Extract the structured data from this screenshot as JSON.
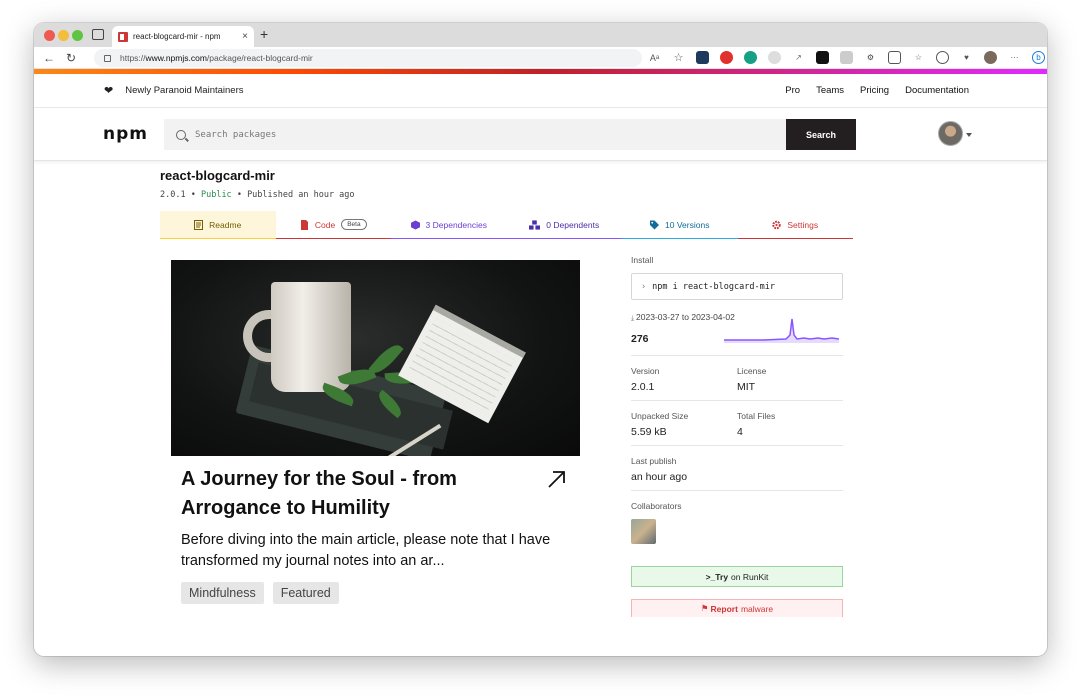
{
  "browser": {
    "tab_title": "react-blogcard-mir - npm",
    "new_tab": "+",
    "url_prefix": "https://",
    "url_domain": "www.npmjs.com",
    "url_path": "/package/react-blogcard-mir"
  },
  "topbar": {
    "tagline": "Newly Paranoid Maintainers",
    "links": [
      "Pro",
      "Teams",
      "Pricing",
      "Documentation"
    ]
  },
  "header": {
    "logo": "npm",
    "search_placeholder": "Search packages",
    "search_button": "Search"
  },
  "package": {
    "name": "react-blogcard-mir",
    "version": "2.0.1",
    "visibility": "Public",
    "published": "Published an hour ago",
    "sep": "•"
  },
  "tabs": {
    "readme": "Readme",
    "code": "Code",
    "code_badge": "Beta",
    "dependencies": "3 Dependencies",
    "dependents": "0 Dependents",
    "versions": "10 Versions",
    "settings": "Settings"
  },
  "readme": {
    "card_title": "A Journey for the Soul - from Arrogance to Humility",
    "card_description": "Before diving into the main article, please note that I have transformed my journal notes into an ar...",
    "tags": [
      "Mindfulness",
      "Featured"
    ]
  },
  "sidebar": {
    "install_label": "Install",
    "install_command": "npm i react-blogcard-mir",
    "downloads_range": "2023-03-27 to 2023-04-02",
    "weekly_downloads": "276",
    "version_label": "Version",
    "version_value": "2.0.1",
    "license_label": "License",
    "license_value": "MIT",
    "unpacked_label": "Unpacked Size",
    "unpacked_value": "5.59 kB",
    "files_label": "Total Files",
    "files_value": "4",
    "last_publish_label": "Last publish",
    "last_publish_value": "an hour ago",
    "collaborators_label": "Collaborators",
    "runkit_prefix": ">_Try",
    "runkit_suffix": "on RunKit",
    "report_prefix": "Report",
    "report_suffix": "malware"
  },
  "colors": {
    "npm_red": "#cb3837",
    "spark_purple": "#8956ff"
  }
}
